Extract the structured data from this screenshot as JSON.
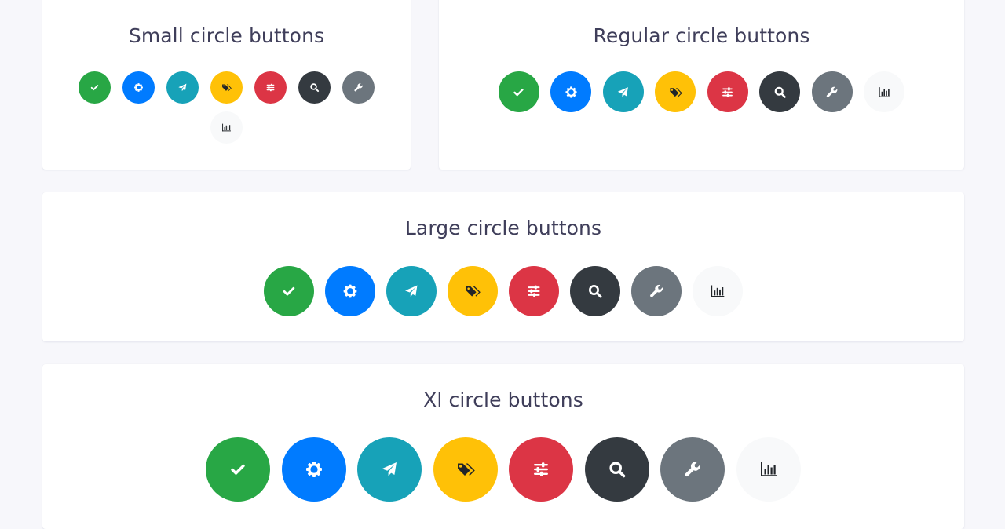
{
  "colors": {
    "page_background": "#f7f7fb",
    "card_background": "#ffffff",
    "title_text": "#3f3e5a",
    "success": "#28a745",
    "primary": "#007bff",
    "info": "#17a2b8",
    "warning": "#ffc107",
    "danger": "#dc3545",
    "dark": "#343a40",
    "secondary": "#6c757d",
    "light": "#f8f9fa"
  },
  "button_set": [
    {
      "variant": "success",
      "icon": "check-icon"
    },
    {
      "variant": "primary",
      "icon": "gear-icon"
    },
    {
      "variant": "info",
      "icon": "paper-plane-icon"
    },
    {
      "variant": "warning",
      "icon": "tags-icon"
    },
    {
      "variant": "danger",
      "icon": "sliders-icon"
    },
    {
      "variant": "dark",
      "icon": "search-icon"
    },
    {
      "variant": "secondary",
      "icon": "wrench-icon"
    },
    {
      "variant": "light",
      "icon": "bar-chart-icon"
    }
  ],
  "sections": [
    {
      "id": "small",
      "title": "Small circle buttons",
      "size": "sm"
    },
    {
      "id": "regular",
      "title": "Regular circle buttons",
      "size": "md"
    },
    {
      "id": "large",
      "title": "Large circle buttons",
      "size": "lg"
    },
    {
      "id": "xl",
      "title": "Xl circle buttons",
      "size": "xl"
    }
  ]
}
